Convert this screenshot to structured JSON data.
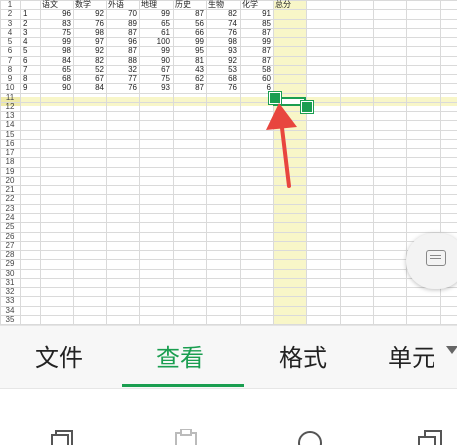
{
  "sheet": {
    "headers": [
      "语文",
      "数学",
      "外语",
      "地理",
      "历史",
      "生物",
      "化学",
      "总分"
    ],
    "row_numbers": [
      "1",
      "2",
      "3",
      "4",
      "5",
      "6",
      "7",
      "8",
      "9",
      "10",
      "11",
      "12",
      "13",
      "14",
      "15",
      "16",
      "17",
      "18",
      "19",
      "20",
      "21",
      "22",
      "23",
      "24",
      "25",
      "26",
      "27",
      "28",
      "29",
      "30",
      "31",
      "32",
      "33",
      "34",
      "35"
    ],
    "rows": [
      [
        "1",
        "96",
        "92",
        "70",
        "99",
        "87",
        "82",
        "91"
      ],
      [
        "2",
        "83",
        "76",
        "89",
        "65",
        "56",
        "74",
        "85"
      ],
      [
        "3",
        "75",
        "98",
        "87",
        "61",
        "66",
        "76",
        "87"
      ],
      [
        "4",
        "99",
        "97",
        "96",
        "100",
        "99",
        "98",
        "99"
      ],
      [
        "5",
        "98",
        "92",
        "87",
        "99",
        "95",
        "93",
        "87"
      ],
      [
        "6",
        "84",
        "82",
        "88",
        "90",
        "81",
        "92",
        "87"
      ],
      [
        "7",
        "65",
        "52",
        "32",
        "67",
        "43",
        "53",
        "58"
      ],
      [
        "8",
        "68",
        "67",
        "77",
        "75",
        "62",
        "68",
        "60"
      ],
      [
        "9",
        "90",
        "84",
        "76",
        "93",
        "87",
        "76",
        "6"
      ]
    ],
    "selected_cell": "H11",
    "highlight_color": "#f8f6c8",
    "selection_color": "#1a9e50",
    "annotation_arrow_color": "#e8463f"
  },
  "tabs": [
    {
      "label": "文件",
      "active": false
    },
    {
      "label": "查看",
      "active": true
    },
    {
      "label": "格式",
      "active": false
    },
    {
      "label": "单元",
      "active": false
    }
  ],
  "floating_button": {
    "icon": "keyboard-icon"
  },
  "bottom_toolbar": {
    "icons": [
      "copy-icon",
      "paste-icon",
      "search-icon",
      "layers-icon"
    ]
  }
}
